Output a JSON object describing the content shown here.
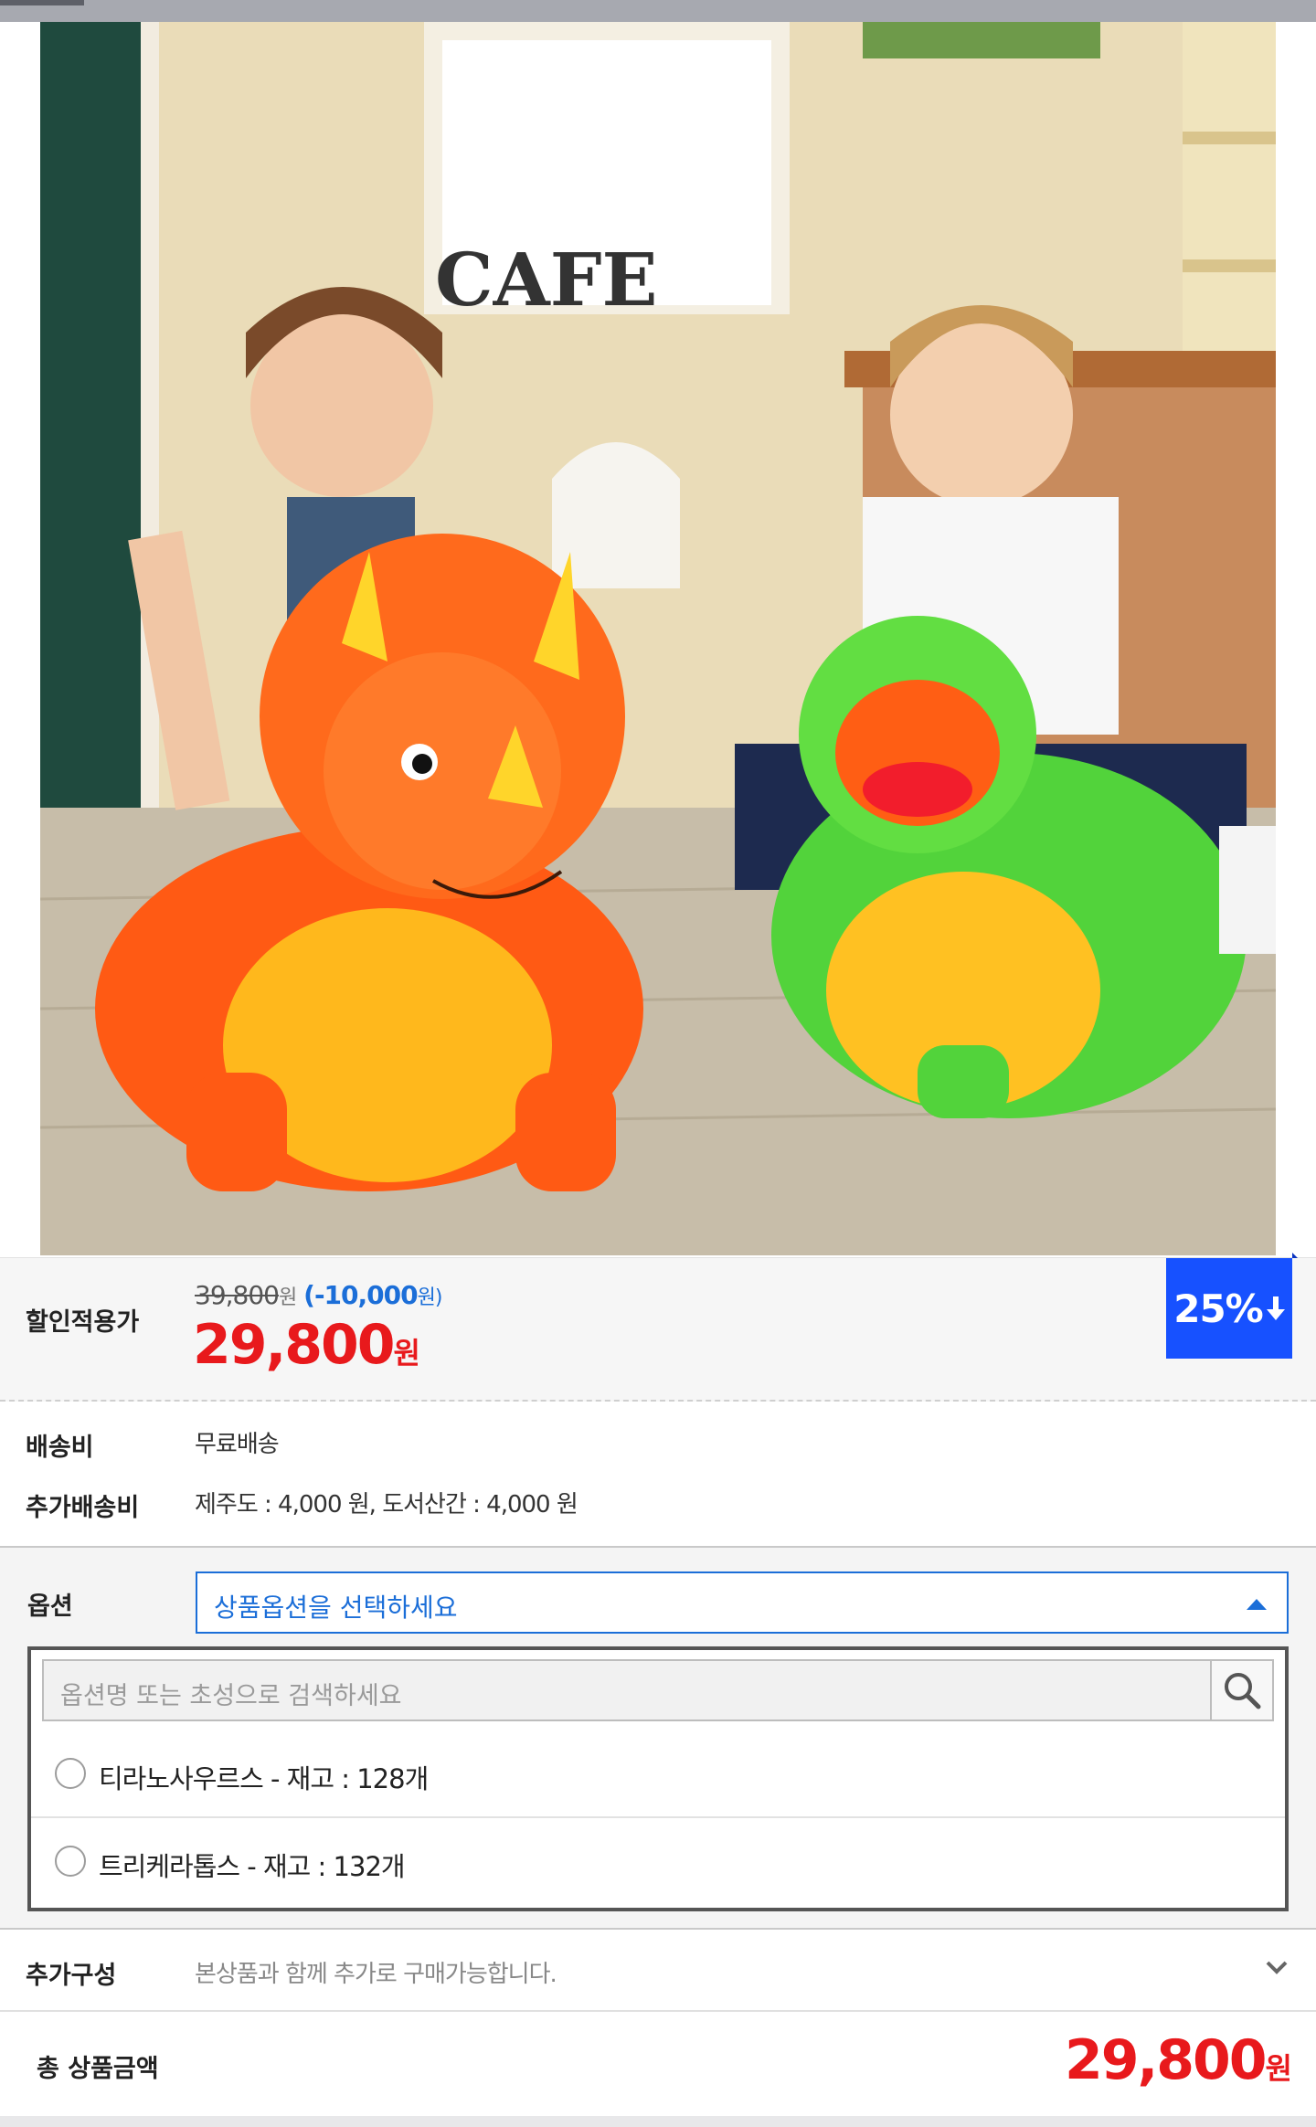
{
  "product": {
    "image_alt": "",
    "photo_sign_text": "CAFE"
  },
  "price": {
    "label": "할인적용가",
    "original": "39,800",
    "original_unit": "원",
    "discount": "(-10,000",
    "discount_unit": "원)",
    "sale": "29,800",
    "sale_unit": "원",
    "discount_badge": "25%",
    "badge_arrow_icon": "arrow-down-icon",
    "accent_red": "#e8191c",
    "accent_blue": "#1b6ed8",
    "badge_blue": "#1751ff"
  },
  "shipping": {
    "fee_label": "배송비",
    "fee_value": "무료배송",
    "extra_label": "추가배송비",
    "extra_value": "제주도 : 4,000 원, 도서산간 : 4,000 원"
  },
  "options": {
    "label": "옵션",
    "select_placeholder": "상품옵션을 선택하세요",
    "search_placeholder": "옵션명 또는 초성으로 검색하세요",
    "search_icon": "search-icon",
    "items": [
      {
        "label": "티라노사우르스 - 재고 : 128개"
      },
      {
        "label": "트리케라톱스 - 재고 : 132개"
      }
    ]
  },
  "addon": {
    "label": "추가구성",
    "description": "본상품과 함께 추가로 구매가능합니다.",
    "expand_icon": "chevron-down-icon"
  },
  "total": {
    "label": "총 상품금액",
    "amount": "29,800",
    "unit": "원"
  }
}
